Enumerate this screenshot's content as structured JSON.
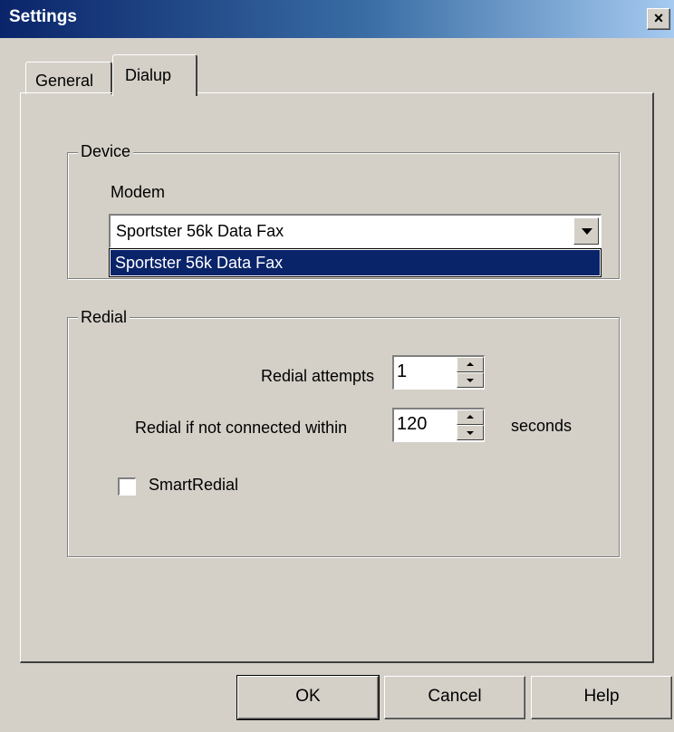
{
  "window": {
    "title": "Settings",
    "close_label": "×"
  },
  "tabs": [
    {
      "label": "General",
      "selected": false
    },
    {
      "label": "Dialup",
      "selected": true
    }
  ],
  "device": {
    "legend": "Device",
    "modem_label": "Modem",
    "modem_value": "Sportster 56k Data Fax",
    "dropdown_options": [
      "Sportster 56k Data Fax"
    ],
    "dropdown_selected_index": 0
  },
  "redial": {
    "legend": "Redial",
    "attempts_label": "Redial attempts",
    "attempts_value": "1",
    "timeout_label": "Redial if not connected within",
    "timeout_value": "120",
    "timeout_unit": "seconds",
    "smart_redial_label": "SmartRedial",
    "smart_redial_checked": false
  },
  "buttons": {
    "ok": "OK",
    "cancel": "Cancel",
    "help": "Help"
  },
  "colors": {
    "face": "#d4d0c8",
    "title_start": "#0a246a",
    "title_end": "#a6caf0",
    "highlight": "#0a246a"
  },
  "icons": [
    "close-icon",
    "dropdown-arrow-icon",
    "spin-up-icon",
    "spin-down-icon"
  ]
}
